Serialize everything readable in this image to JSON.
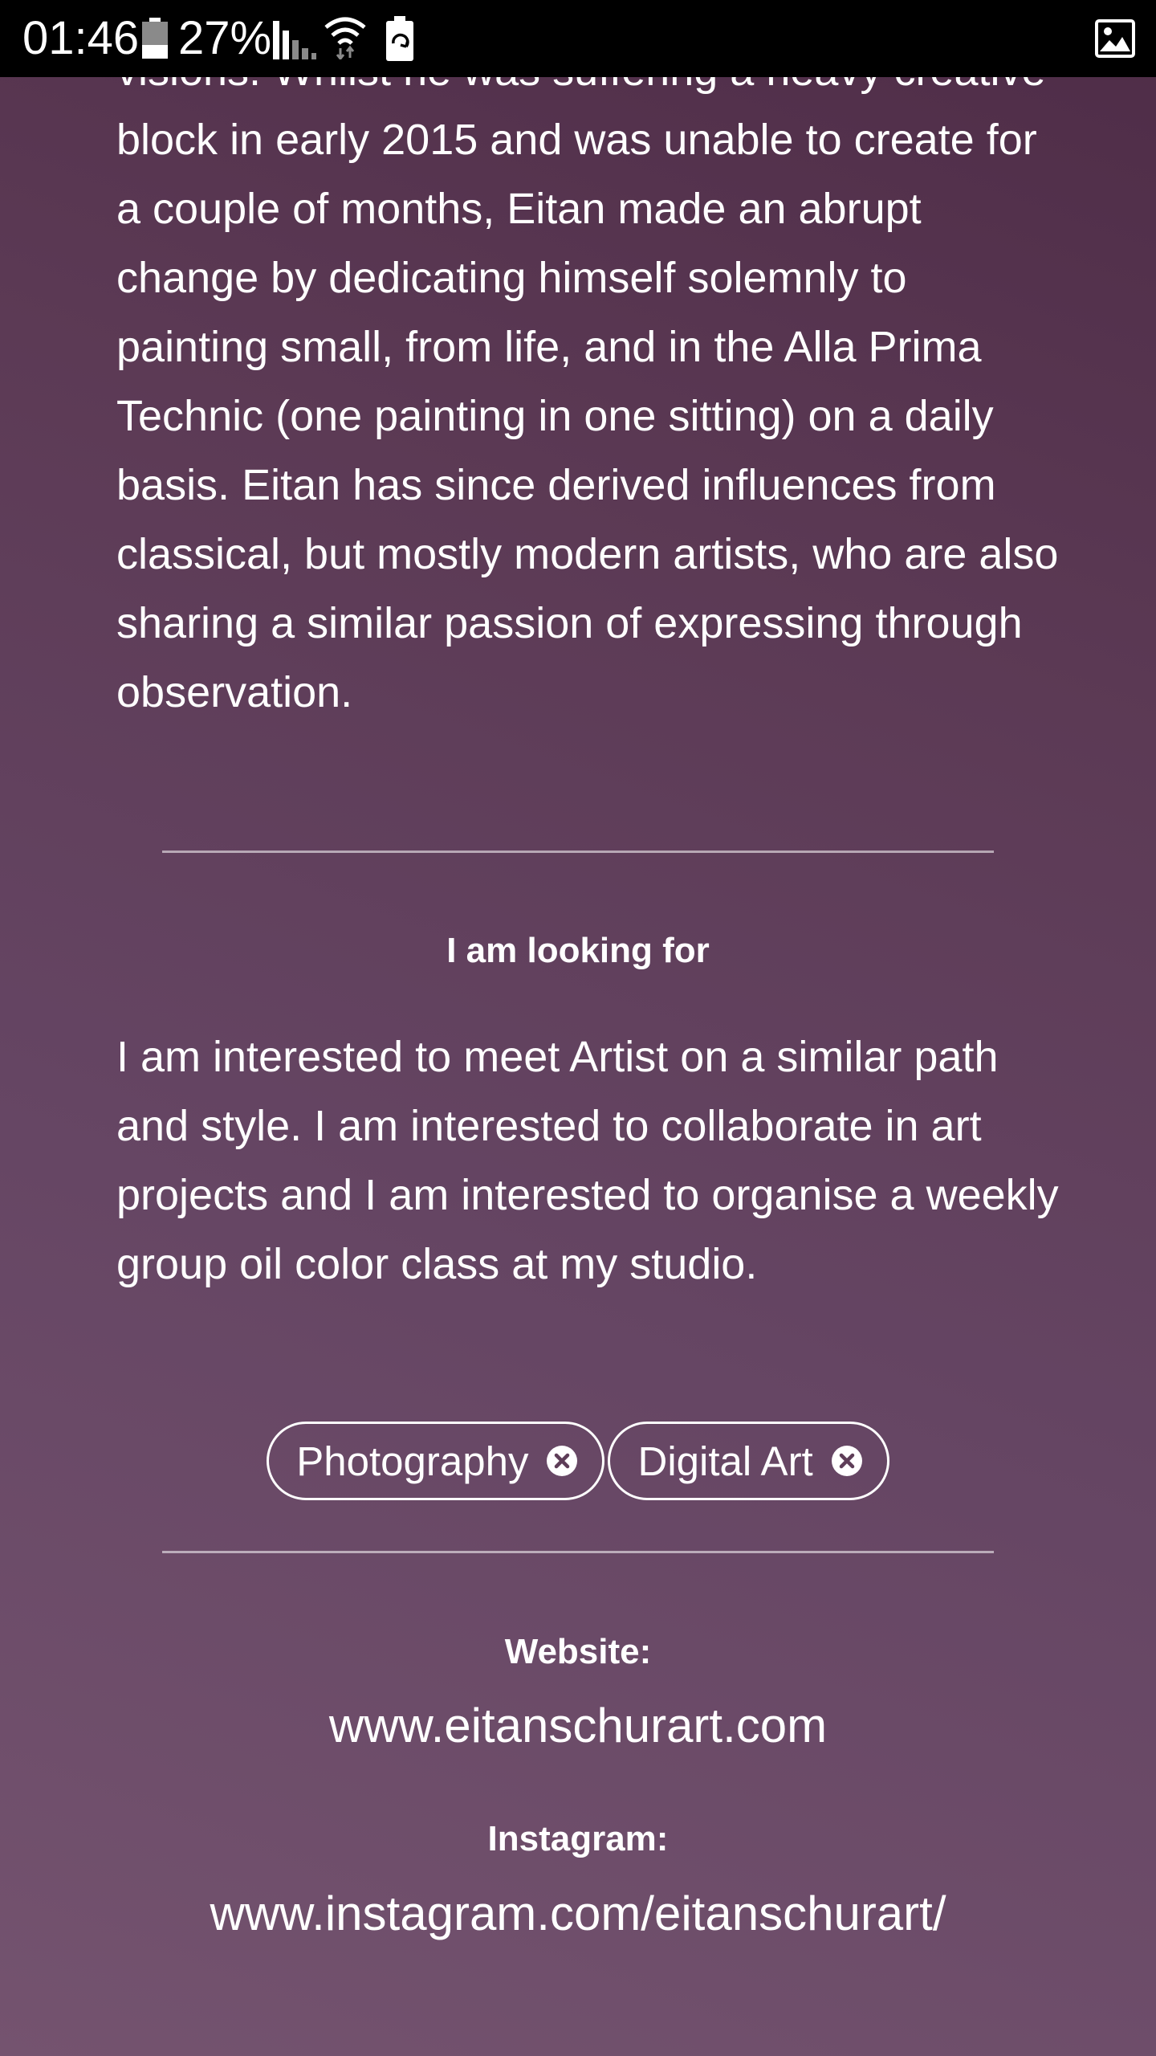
{
  "status_bar": {
    "time": "01:46",
    "battery_percent": "27%",
    "icons": [
      "battery-icon",
      "signal-icon",
      "wifi-icon",
      "battery-saver-icon",
      "image-notification-icon"
    ]
  },
  "about": {
    "paragraph": "visions. Whilst he was suffering a heavy creative block in early 2015 and was unable to create for a couple of months, Eitan made an abrupt change by dedicating himself solemnly to painting small, from life, and in the Alla Prima Technic (one painting in one sitting) on a daily basis. Eitan has since derived influences from classical, but mostly modern artists, who are also sharing a similar passion of expressing through observation."
  },
  "looking_for": {
    "heading": "I am looking for",
    "paragraph": "I am interested to meet Artist on a similar path and style. I am interested to collaborate in art projects and I am interested to organise a weekly group oil color class at my studio."
  },
  "tags": [
    {
      "label": "Photography"
    },
    {
      "label": "Digital Art"
    }
  ],
  "links": {
    "website_label": "Website:",
    "website_value": "www.eitanschurart.com",
    "instagram_label": "Instagram:",
    "instagram_value": "www.instagram.com/eitanschurart/"
  },
  "colors": {
    "background_top": "#4e2c47",
    "background_bottom": "#74536f",
    "text": "#ffffff"
  }
}
